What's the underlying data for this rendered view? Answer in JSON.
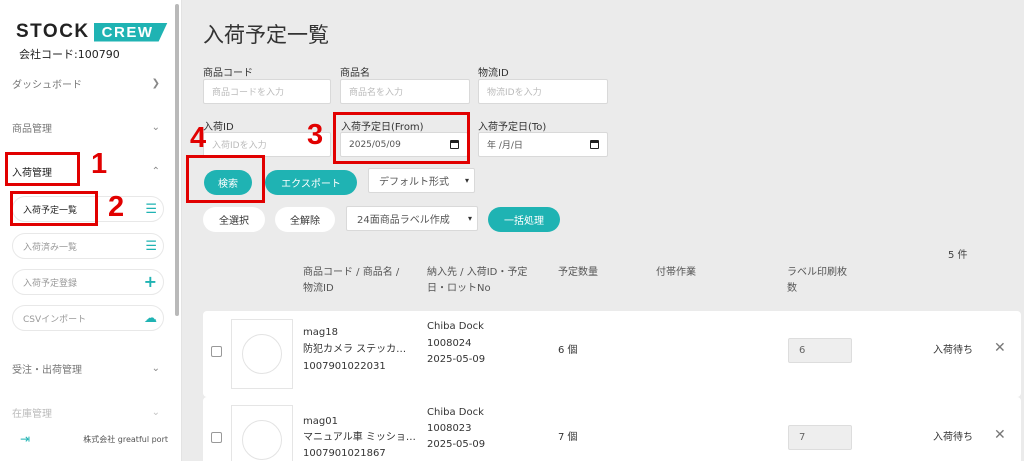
{
  "brand": {
    "stock": "STOCK",
    "crew": "CREW"
  },
  "sidebar": {
    "company_code": "会社コード:100790",
    "items": [
      {
        "label": "ダッシュボード"
      },
      {
        "label": "商品管理"
      },
      {
        "label": "入荷管理"
      },
      {
        "label": "受注・出荷管理"
      },
      {
        "label": "在庫管理"
      }
    ],
    "sub_items": [
      {
        "label": "入荷予定一覧"
      },
      {
        "label": "入荷済み一覧"
      },
      {
        "label": "入荷予定登録"
      },
      {
        "label": "CSVインポート"
      }
    ],
    "footer_company": "株式会社 greatful port"
  },
  "page": {
    "title": "入荷予定一覧"
  },
  "filters": {
    "product_code": {
      "label": "商品コード",
      "placeholder": "商品コードを入力"
    },
    "product_name": {
      "label": "商品名",
      "placeholder": "商品名を入力"
    },
    "logistics_id": {
      "label": "物流ID",
      "placeholder": "物流IDを入力"
    },
    "arrival_id": {
      "label": "入荷ID",
      "placeholder": "入荷IDを入力"
    },
    "date_from": {
      "label": "入荷予定日(From)",
      "value": "2025/05/09"
    },
    "date_to": {
      "label": "入荷予定日(To)",
      "value": "年 /月/日"
    }
  },
  "actions": {
    "search": "検索",
    "export": "エクスポート",
    "format_select": "デフォルト形式",
    "select_all": "全選択",
    "deselect_all": "全解除",
    "label_select": "24面商品ラベル作成",
    "bulk": "一括処理"
  },
  "count": "5 件",
  "table": {
    "headers": {
      "product": [
        "商品コード / 商品名 /",
        "物流ID"
      ],
      "dest": [
        "納入先 / 入荷ID・予定",
        "日・ロットNo"
      ],
      "qty": "予定数量",
      "work": "付帯作業",
      "label_count": [
        "ラベル印刷枚",
        "数"
      ]
    },
    "rows": [
      {
        "code": "mag18",
        "name": "防犯カメラ ステッカ…",
        "logistics_id": "1007901022031",
        "dest": "Chiba Dock",
        "arrival_id": "1008024",
        "date": "2025-05-09",
        "qty": "6 個",
        "label_count": "6",
        "status": "入荷待ち"
      },
      {
        "code": "mag01",
        "name": "マニュアル車 ミッショ…",
        "logistics_id": "1007901021867",
        "dest": "Chiba Dock",
        "arrival_id": "1008023",
        "date": "2025-05-09",
        "qty": "7 個",
        "label_count": "7",
        "status": "入荷待ち"
      }
    ]
  },
  "annotations": [
    "1",
    "2",
    "3",
    "4"
  ],
  "colors": {
    "accent": "#1fb3b3",
    "annotation": "#e10000"
  }
}
